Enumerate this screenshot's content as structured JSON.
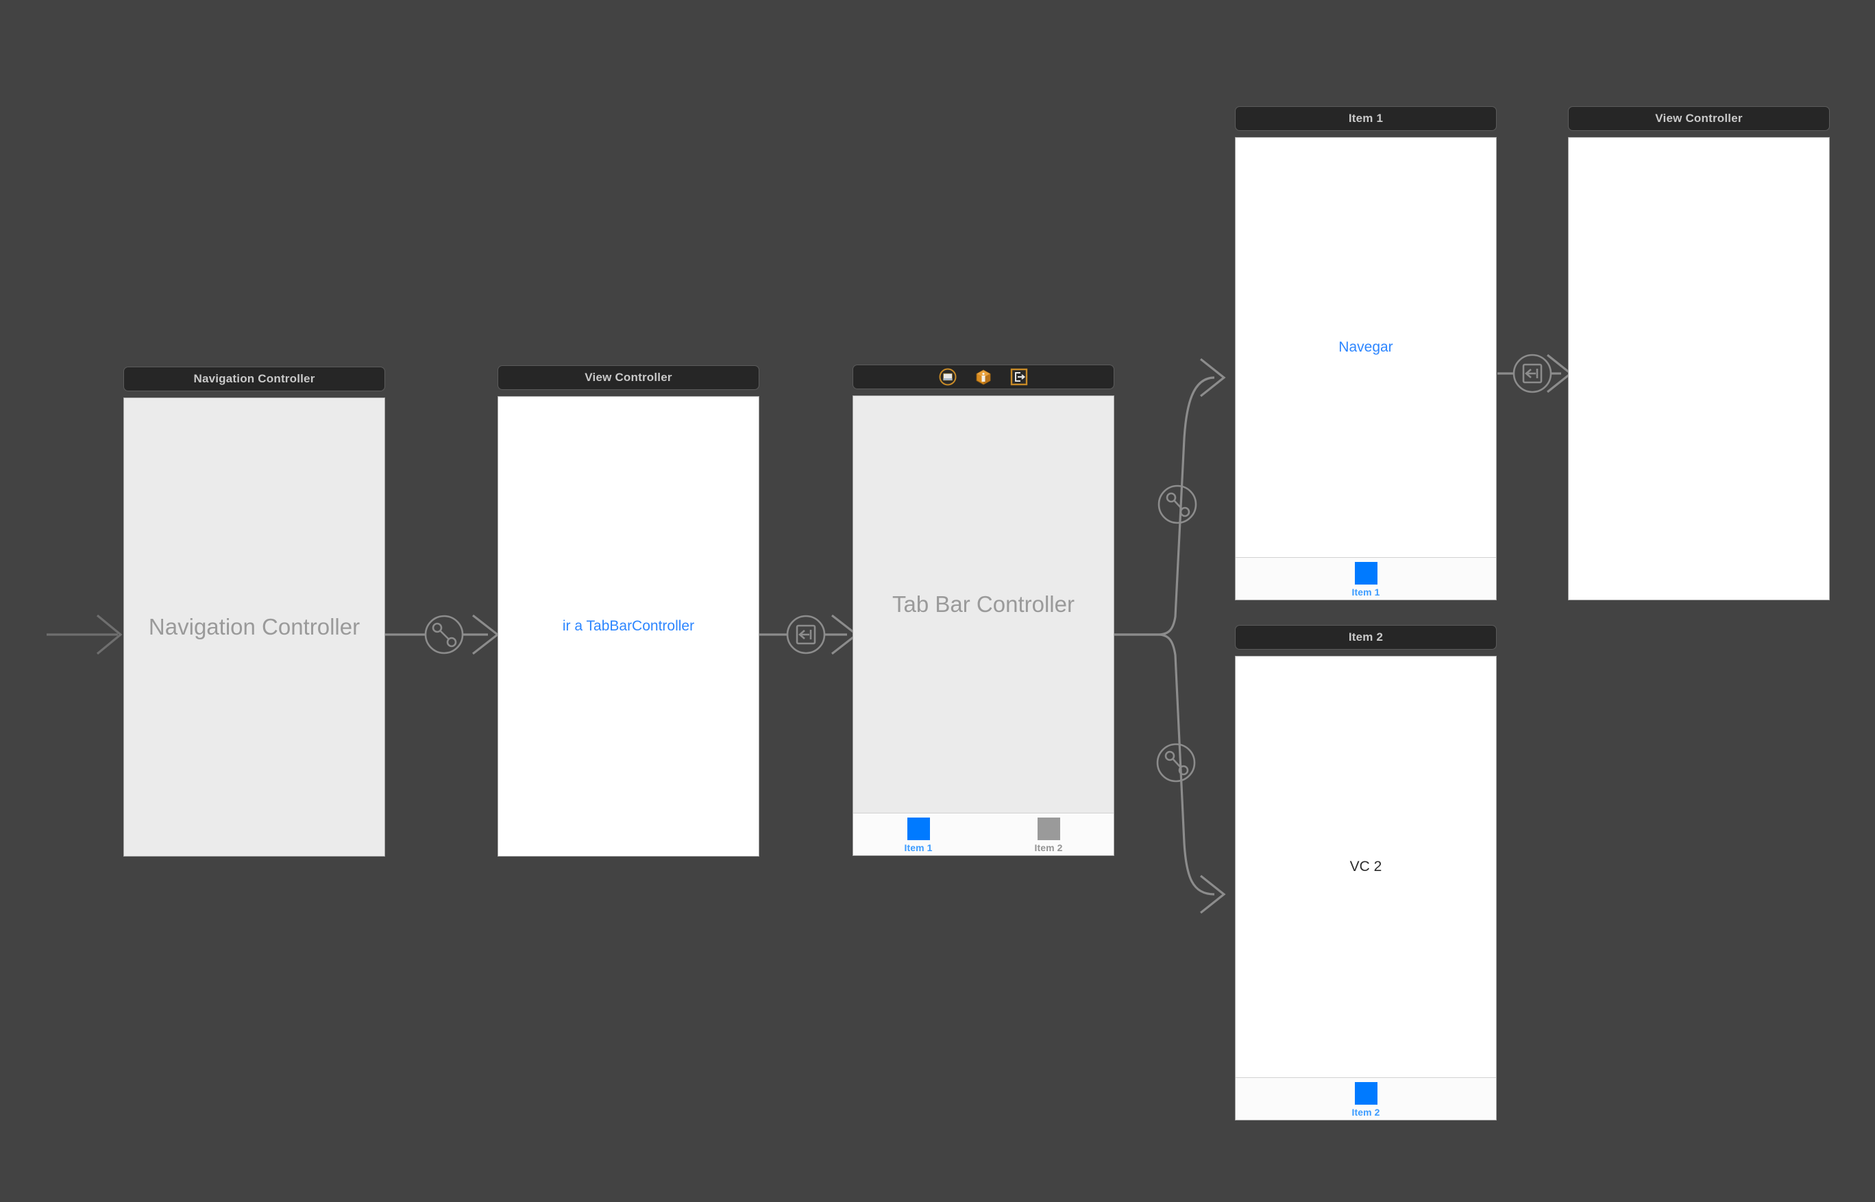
{
  "canvas": {
    "background_color": "#434343",
    "tool": "storyboard-canvas"
  },
  "colors": {
    "canvas_background": "#434343",
    "scene_title_background": "#262626",
    "scene_title_text": "#c9c9c9",
    "wire": "#8c8c8c",
    "ios_blue": "#007aff",
    "tab_label_selected": "#3c9cff",
    "tab_label_unselected": "#949494",
    "placeholder_text": "#9a9a9a",
    "dock_gold": "#c98b27"
  },
  "scenes": [
    {
      "id": "navigation-controller",
      "title": "Navigation Controller",
      "placeholder": "Navigation Controller",
      "is_initial": true
    },
    {
      "id": "view-controller-source",
      "title": "View Controller",
      "button_label": "ir a TabBarController"
    },
    {
      "id": "tab-bar-controller",
      "title": "",
      "placeholder": "Tab Bar Controller",
      "dock_icons": [
        {
          "name": "view-controller-icon",
          "label": "View Controller"
        },
        {
          "name": "first-responder-icon",
          "label": "First Responder"
        },
        {
          "name": "exit-icon",
          "label": "Exit"
        }
      ],
      "tabs": [
        {
          "label": "Item 1",
          "selected": true
        },
        {
          "label": "Item 2",
          "selected": false
        }
      ]
    },
    {
      "id": "item-1",
      "title": "Item 1",
      "button_label": "Navegar",
      "tabs": [
        {
          "label": "Item 1",
          "selected": true
        }
      ]
    },
    {
      "id": "item-2",
      "title": "Item 2",
      "text_label": "VC 2",
      "tabs": [
        {
          "label": "Item 2",
          "selected": true
        }
      ]
    },
    {
      "id": "view-controller-destination",
      "title": "View Controller"
    }
  ],
  "segues": [
    {
      "id": "entry-arrow",
      "type": "initial-view-controller",
      "icon": "arrow"
    },
    {
      "id": "nav-root-segue",
      "type": "relationship-root-view-controller",
      "icon": "relationship-icon"
    },
    {
      "id": "show-tabbar-segue",
      "type": "present-modally",
      "icon": "modal-icon"
    },
    {
      "id": "tab-item1-relationship",
      "type": "relationship-view-controllers",
      "icon": "relationship-icon"
    },
    {
      "id": "tab-item2-relationship",
      "type": "relationship-view-controllers",
      "icon": "relationship-icon"
    },
    {
      "id": "navegar-segue",
      "type": "present-modally",
      "icon": "modal-icon"
    }
  ]
}
